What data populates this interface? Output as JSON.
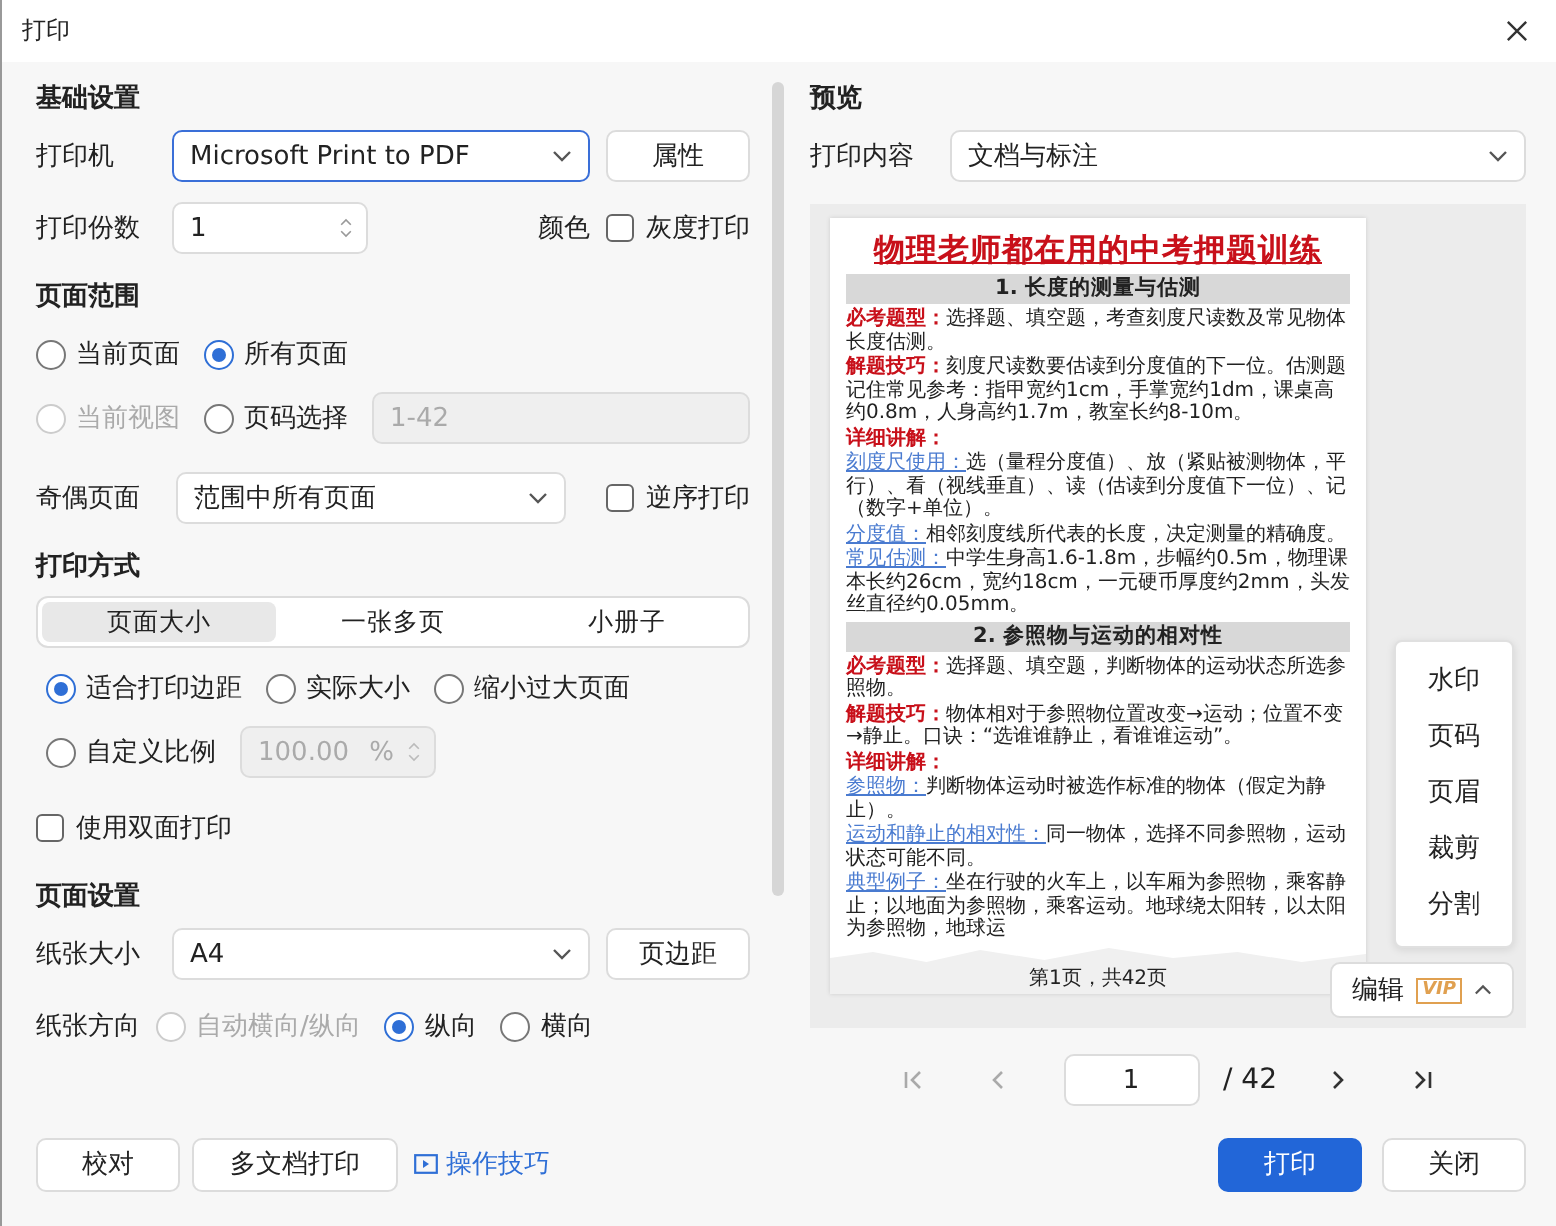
{
  "window": {
    "title": "打印"
  },
  "basic": {
    "heading": "基础设置",
    "printer": {
      "label": "打印机",
      "value": "Microsoft Print to PDF"
    },
    "properties_button": "属性",
    "copies": {
      "label": "打印份数",
      "value": "1"
    },
    "color_label": "颜色",
    "grayscale": {
      "label": "灰度打印",
      "checked": false
    }
  },
  "page_range": {
    "heading": "页面范围",
    "options": [
      {
        "label": "当前页面",
        "selected": false,
        "disabled": false
      },
      {
        "label": "所有页面",
        "selected": true,
        "disabled": false
      },
      {
        "label": "当前视图",
        "selected": false,
        "disabled": true
      },
      {
        "label": "页码选择",
        "selected": false,
        "disabled": false
      }
    ],
    "pages_field": {
      "value": "1-42",
      "disabled": true
    },
    "odd_even": {
      "label": "奇偶页面",
      "value": "范围中所有页面"
    },
    "reverse": {
      "label": "逆序打印",
      "checked": false
    }
  },
  "print_mode": {
    "heading": "打印方式",
    "tabs": [
      {
        "label": "页面大小",
        "selected": true
      },
      {
        "label": "一张多页",
        "selected": false
      },
      {
        "label": "小册子",
        "selected": false
      }
    ],
    "scale_options": [
      {
        "label": "适合打印边距",
        "selected": true
      },
      {
        "label": "实际大小",
        "selected": false
      },
      {
        "label": "缩小过大页面",
        "selected": false
      },
      {
        "label": "自定义比例",
        "selected": false
      }
    ],
    "custom_scale": {
      "value": "100.00",
      "unit": "%",
      "disabled": true
    },
    "duplex": {
      "label": "使用双面打印",
      "checked": false
    }
  },
  "page_setup": {
    "heading": "页面设置",
    "paper_size": {
      "label": "纸张大小",
      "value": "A4"
    },
    "margins_button": "页边距",
    "orientation": {
      "label": "纸张方向",
      "options": [
        {
          "label": "自动横向/纵向",
          "selected": false,
          "disabled": true
        },
        {
          "label": "纵向",
          "selected": true,
          "disabled": false
        },
        {
          "label": "横向",
          "selected": false,
          "disabled": false
        }
      ]
    }
  },
  "footer_left": {
    "buttons": [
      "校对",
      "多文档打印"
    ],
    "link": "操作技巧"
  },
  "preview": {
    "heading": "预览",
    "content": {
      "label": "打印内容",
      "value": "文档与标注"
    },
    "document": [
      {
        "kind": "title",
        "text": "物理老师都在用的中考押题训练"
      },
      {
        "kind": "section",
        "text": "1. 长度的测量与估测"
      },
      {
        "kind": "para",
        "label": "必考题型：",
        "link": false,
        "text": "选择题、填空题，考查刻度尺读数及常见物体长度估测。"
      },
      {
        "kind": "para",
        "label": "解题技巧：",
        "link": false,
        "text": "刻度尺读数要估读到分度值的下一位。估测题记住常见参考：指甲宽约1cm，手掌宽约1dm，课桌高约0.8m，人身高约1.7m，教室长约8-10m。"
      },
      {
        "kind": "para",
        "label": "详细讲解：",
        "link": false
      },
      {
        "kind": "para",
        "label": "刻度尺使用：",
        "link": true,
        "text": "选（量程分度值）、放（紧贴被测物体，平行）、看（视线垂直）、读（估读到分度值下一位）、记（数字+单位）。"
      },
      {
        "kind": "para",
        "label": "分度值：",
        "link": true,
        "text": "相邻刻度线所代表的长度，决定测量的精确度。"
      },
      {
        "kind": "para",
        "label": "常见估测：",
        "link": true,
        "text": "中学生身高1.6-1.8m，步幅约0.5m，物理课本长约26cm，宽约18cm，一元硬币厚度约2mm，头发丝直径约0.05mm。"
      },
      {
        "kind": "section",
        "text": "2. 参照物与运动的相对性"
      },
      {
        "kind": "para",
        "label": "必考题型：",
        "link": false,
        "text": "选择题、填空题，判断物体的运动状态所选参照物。"
      },
      {
        "kind": "para",
        "label": "解题技巧：",
        "link": false,
        "text": "物体相对于参照物位置改变→运动；位置不变→静止。口诀：“选谁谁静止，看谁谁运动”。"
      },
      {
        "kind": "para",
        "label": "详细讲解：",
        "link": false
      },
      {
        "kind": "para",
        "label": "参照物：",
        "link": true,
        "text": "判断物体运动时被选作标准的物体（假定为静止）。"
      },
      {
        "kind": "para",
        "label": "运动和静止的相对性：",
        "link": true,
        "text": "同一物体，选择不同参照物，运动状态可能不同。"
      },
      {
        "kind": "para",
        "label": "典型例子：",
        "link": true,
        "text": "坐在行驶的火车上，以车厢为参照物，乘客静止；以地面为参照物，乘客运动。地球绕太阳转，以太阳为参照物，地球运"
      },
      {
        "kind": "footer",
        "text": "第1页，共42页"
      }
    ],
    "edit_button": {
      "label": "编辑",
      "badge": "VIP",
      "expanded": true
    },
    "edit_menu": [
      "水印",
      "页码",
      "页眉",
      "裁剪",
      "分割"
    ],
    "pager": {
      "page": "1",
      "total": "/ 42"
    }
  },
  "actions": [
    {
      "label": "打印",
      "primary": true
    },
    {
      "label": "关闭",
      "primary": false
    }
  ]
}
